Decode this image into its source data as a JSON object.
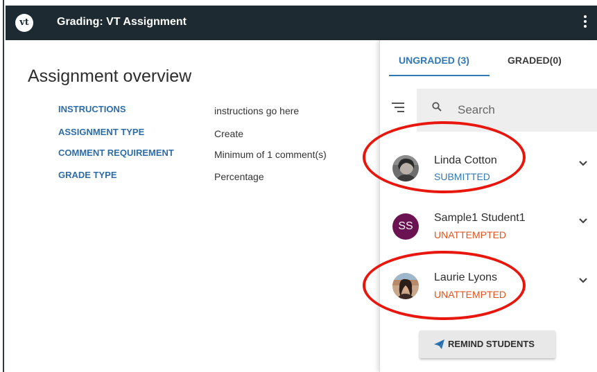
{
  "header": {
    "logo_text": "vt",
    "title": "Grading: VT Assignment",
    "menu_icon": "kebab-menu-icon"
  },
  "overview": {
    "title": "Assignment overview",
    "rows": [
      {
        "label": "INSTRUCTIONS",
        "value": "instructions go here"
      },
      {
        "label": "ASSIGNMENT TYPE",
        "value": "Create"
      },
      {
        "label": "COMMENT REQUIREMENT",
        "value": "Minimum of 1 comment(s)"
      },
      {
        "label": "GRADE TYPE",
        "value": "Percentage"
      }
    ]
  },
  "panel": {
    "tabs": [
      {
        "label": "UNGRADED (3)",
        "active": true
      },
      {
        "label": "GRADED(0)",
        "active": false
      }
    ],
    "filter_icon": "filter-icon",
    "search": {
      "placeholder": "Search",
      "icon": "search-icon"
    },
    "students": [
      {
        "name": "Linda Cotton",
        "status": "SUBMITTED",
        "status_color": "#2f78b7",
        "avatar": "photo"
      },
      {
        "name": "Sample1 Student1",
        "status": "UNATTEMPTED",
        "status_color": "#e2541d",
        "avatar_initials": "SS",
        "avatar_color": "#6b1352"
      },
      {
        "name": "Laurie Lyons",
        "status": "UNATTEMPTED",
        "status_color": "#e2541d",
        "avatar": "photo"
      }
    ],
    "remind_button": "REMIND STUDENTS"
  },
  "colors": {
    "header_bg": "#1e2a31",
    "accent_blue": "#2f78b7",
    "status_orange": "#e2541d",
    "annotation_red": "#e8160c"
  }
}
